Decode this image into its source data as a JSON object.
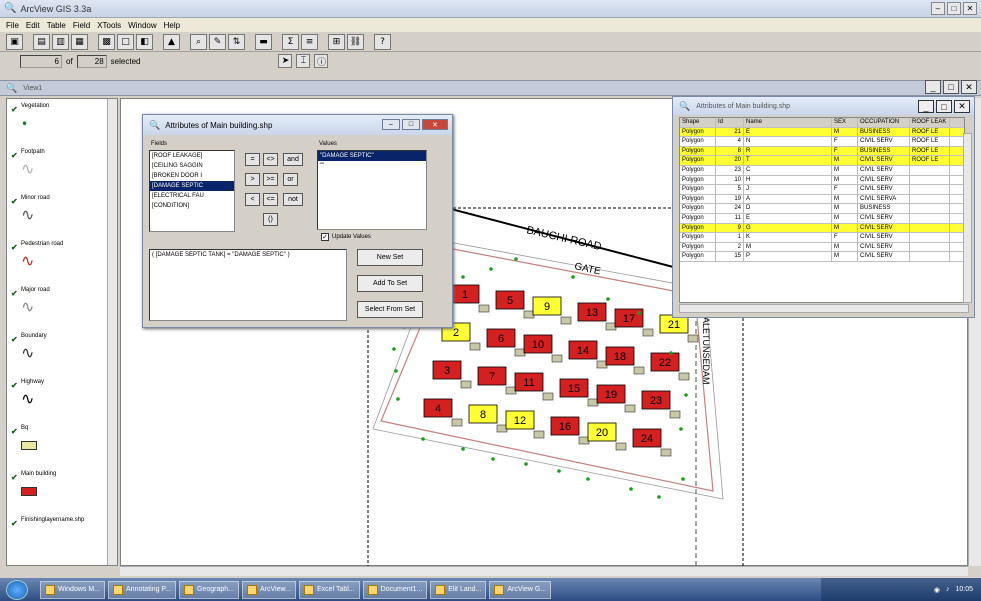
{
  "app": {
    "title": "ArcView GIS 3.3a"
  },
  "menu": [
    "File",
    "Edit",
    "Table",
    "Field",
    "XTools",
    "Window",
    "Help"
  ],
  "toolbar2": {
    "count_value": "6",
    "of_label": "of",
    "total_value": "28",
    "selected_label": "selected"
  },
  "view": {
    "title": "View1"
  },
  "toc": [
    {
      "label": "Vegetation",
      "symbol": "point",
      "color": "#1a7a1a"
    },
    {
      "label": "Footpath",
      "symbol": "line",
      "color": "#b0b0b0"
    },
    {
      "label": "Minor road",
      "symbol": "line",
      "color": "#555555"
    },
    {
      "label": "Pedestrian road",
      "symbol": "line",
      "color": "#cc2222"
    },
    {
      "label": "Major road",
      "symbol": "line",
      "color": "#888888"
    },
    {
      "label": "Boundary",
      "symbol": "line",
      "color": "#333333"
    },
    {
      "label": "Highway",
      "symbol": "line",
      "color": "#000000"
    },
    {
      "label": "Bq",
      "symbol": "rect",
      "color": "#e8e8a0"
    },
    {
      "label": "Main building",
      "symbol": "rect",
      "color": "#d42020"
    },
    {
      "label": "Finishinglayername.shp",
      "symbol": "none",
      "color": "#000000"
    }
  ],
  "query_dialog": {
    "title": "Attributes of Main building.shp",
    "fields_label": "Fields",
    "fields": [
      "[ROOF LEAKAGE]",
      "[CEILING SAGGIN",
      "[BROKEN DOOR I",
      "[DAMAGE SEPTIC",
      "[ELECTRICAL FAU",
      "[CONDITION]"
    ],
    "selected_field_index": 3,
    "values_label": "Values",
    "values": [
      "\"DAMAGE SEPTIC\"",
      "\"\""
    ],
    "operators": [
      "=",
      "<>",
      "and",
      ">",
      ">=",
      "or",
      "<",
      "<=",
      "not",
      "()"
    ],
    "update_values_label": "Update Values",
    "expression": "( [DAMAGE SEPTIC TANK] = \"DAMAGE SEPTIC\" )",
    "new_set_label": "New Set",
    "add_to_set_label": "Add To Set",
    "select_from_set_label": "Select From Set"
  },
  "attr_table": {
    "title": "Attributes of Main building.shp",
    "columns": [
      "Shape",
      "Id",
      "Name",
      "SEX",
      "OCCUPATION",
      "ROOF LEAK"
    ],
    "rows": [
      {
        "shape": "Polygon",
        "id": "21",
        "name": "E",
        "sex": "M",
        "occ": "BUSINESS",
        "roof": "ROOF LE",
        "hl": true
      },
      {
        "shape": "Polygon",
        "id": "4",
        "name": "N",
        "sex": "F",
        "occ": "CIVIL SERV",
        "roof": "ROOF LE",
        "hl": false
      },
      {
        "shape": "Polygon",
        "id": "8",
        "name": "R",
        "sex": "F",
        "occ": "BUSINESS",
        "roof": "ROOF LE",
        "hl": true
      },
      {
        "shape": "Polygon",
        "id": "20",
        "name": "T",
        "sex": "M",
        "occ": "CIVIL SERV",
        "roof": "ROOF LE",
        "hl": true
      },
      {
        "shape": "Polygon",
        "id": "23",
        "name": "C",
        "sex": "M",
        "occ": "CIVIL SERV",
        "roof": "",
        "hl": false
      },
      {
        "shape": "Polygon",
        "id": "10",
        "name": "H",
        "sex": "M",
        "occ": "CIVIL SERV",
        "roof": "",
        "hl": false
      },
      {
        "shape": "Polygon",
        "id": "5",
        "name": "J",
        "sex": "F",
        "occ": "CIVIL SERV",
        "roof": "",
        "hl": false
      },
      {
        "shape": "Polygon",
        "id": "19",
        "name": "A",
        "sex": "M",
        "occ": "CIVIL SERVA",
        "roof": "",
        "hl": false
      },
      {
        "shape": "Polygon",
        "id": "24",
        "name": "D",
        "sex": "M",
        "occ": "BUSINESS",
        "roof": "",
        "hl": false
      },
      {
        "shape": "Polygon",
        "id": "11",
        "name": "E",
        "sex": "M",
        "occ": "CIVIL SERV",
        "roof": "",
        "hl": false
      },
      {
        "shape": "Polygon",
        "id": "9",
        "name": "G",
        "sex": "M",
        "occ": "CIVIL SERV",
        "roof": "",
        "hl": true
      },
      {
        "shape": "Polygon",
        "id": "1",
        "name": "K",
        "sex": "F",
        "occ": "CIVIL SERV",
        "roof": "",
        "hl": false
      },
      {
        "shape": "Polygon",
        "id": "2",
        "name": "M",
        "sex": "M",
        "occ": "CIVIL SERV",
        "roof": "",
        "hl": false
      },
      {
        "shape": "Polygon",
        "id": "15",
        "name": "P",
        "sex": "M",
        "occ": "CIVIL SERV",
        "roof": "",
        "hl": false
      }
    ]
  },
  "map": {
    "road_label": "BAUCHI ROAD",
    "gate_label": "GATE",
    "side_label": "BALETUNSEDAM",
    "buildings": [
      {
        "n": "1",
        "yellow": false
      },
      {
        "n": "5",
        "yellow": false
      },
      {
        "n": "9",
        "yellow": true
      },
      {
        "n": "13",
        "yellow": false
      },
      {
        "n": "17",
        "yellow": false
      },
      {
        "n": "21",
        "yellow": true
      },
      {
        "n": "2",
        "yellow": true
      },
      {
        "n": "6",
        "yellow": false
      },
      {
        "n": "10",
        "yellow": false
      },
      {
        "n": "14",
        "yellow": false
      },
      {
        "n": "18",
        "yellow": false
      },
      {
        "n": "22",
        "yellow": false
      },
      {
        "n": "3",
        "yellow": false
      },
      {
        "n": "7",
        "yellow": false
      },
      {
        "n": "11",
        "yellow": false
      },
      {
        "n": "15",
        "yellow": false
      },
      {
        "n": "19",
        "yellow": false
      },
      {
        "n": "23",
        "yellow": false
      },
      {
        "n": "4",
        "yellow": false
      },
      {
        "n": "8",
        "yellow": true
      },
      {
        "n": "12",
        "yellow": true
      },
      {
        "n": "16",
        "yellow": false
      },
      {
        "n": "20",
        "yellow": true
      },
      {
        "n": "24",
        "yellow": false
      }
    ],
    "colors": {
      "red": "#d42020",
      "yellow": "#ffff33",
      "bq": "#c8c8a8",
      "tree": "#19a019",
      "boundary": "#c98080"
    }
  },
  "taskbar": {
    "items": [
      "Windows M...",
      "Annotating P...",
      "Geograph...",
      "ArcView...",
      "Excel Tabl...",
      "Document1...",
      "Elit Land...",
      "ArcView G..."
    ],
    "clock": "10:05"
  }
}
